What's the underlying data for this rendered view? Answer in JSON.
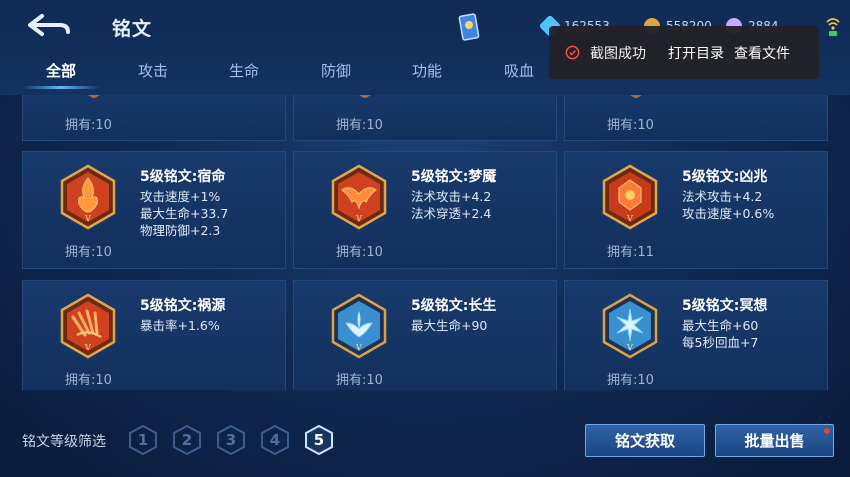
{
  "header": {
    "title": "铭文",
    "currencies": [
      {
        "icon": "diamond-icon",
        "value": "162553",
        "color": "#4fc3ff"
      },
      {
        "icon": "gold-coin-icon",
        "value": "558200",
        "color": "#d9a441"
      },
      {
        "icon": "gem-icon",
        "value": "2884",
        "color": "#c9a8ff"
      }
    ]
  },
  "tabs": [
    {
      "label": "全部",
      "active": true
    },
    {
      "label": "攻击"
    },
    {
      "label": "生命"
    },
    {
      "label": "防御"
    },
    {
      "label": "功能"
    },
    {
      "label": "吸血"
    }
  ],
  "toast": {
    "message": "截图成功",
    "action1": "打开目录",
    "action2": "查看文件"
  },
  "partial_row": [
    {
      "owned": "拥有:10"
    },
    {
      "owned": "拥有:10"
    },
    {
      "owned": "拥有:10"
    }
  ],
  "inscriptions": [
    {
      "name": "5级铭文:宿命",
      "stats": [
        "攻击速度+1%",
        "最大生命+33.7",
        "物理防御+2.3"
      ],
      "owned": "拥有:10",
      "color": "red",
      "emblem": "fate-emblem-icon"
    },
    {
      "name": "5级铭文:梦魇",
      "stats": [
        "法术攻击+4.2",
        "法术穿透+2.4"
      ],
      "owned": "拥有:10",
      "color": "red",
      "emblem": "nightmare-emblem-icon"
    },
    {
      "name": "5级铭文:凶兆",
      "stats": [
        "法术攻击+4.2",
        "攻击速度+0.6%"
      ],
      "owned": "拥有:11",
      "color": "red",
      "emblem": "omen-emblem-icon"
    },
    {
      "name": "5级铭文:祸源",
      "stats": [
        "暴击率+1.6%"
      ],
      "owned": "拥有:10",
      "color": "red",
      "emblem": "calamity-emblem-icon"
    },
    {
      "name": "5级铭文:长生",
      "stats": [
        "最大生命+90"
      ],
      "owned": "拥有:10",
      "color": "blue",
      "emblem": "longevity-emblem-icon"
    },
    {
      "name": "5级铭文:冥想",
      "stats": [
        "最大生命+60",
        "每5秒回血+7"
      ],
      "owned": "拥有:10",
      "color": "blue",
      "emblem": "meditation-emblem-icon"
    }
  ],
  "filter": {
    "label": "铭文等级筛选",
    "levels": [
      "1",
      "2",
      "3",
      "4",
      "5"
    ],
    "selected": "5"
  },
  "buttons": {
    "obtain": "铭文获取",
    "bulk_sell": "批量出售"
  },
  "colors": {
    "red_emblem": "#d0421f",
    "blue_emblem": "#3a8fd0",
    "gold_frame": "#e2a64a",
    "accent": "#5fb8ff"
  }
}
